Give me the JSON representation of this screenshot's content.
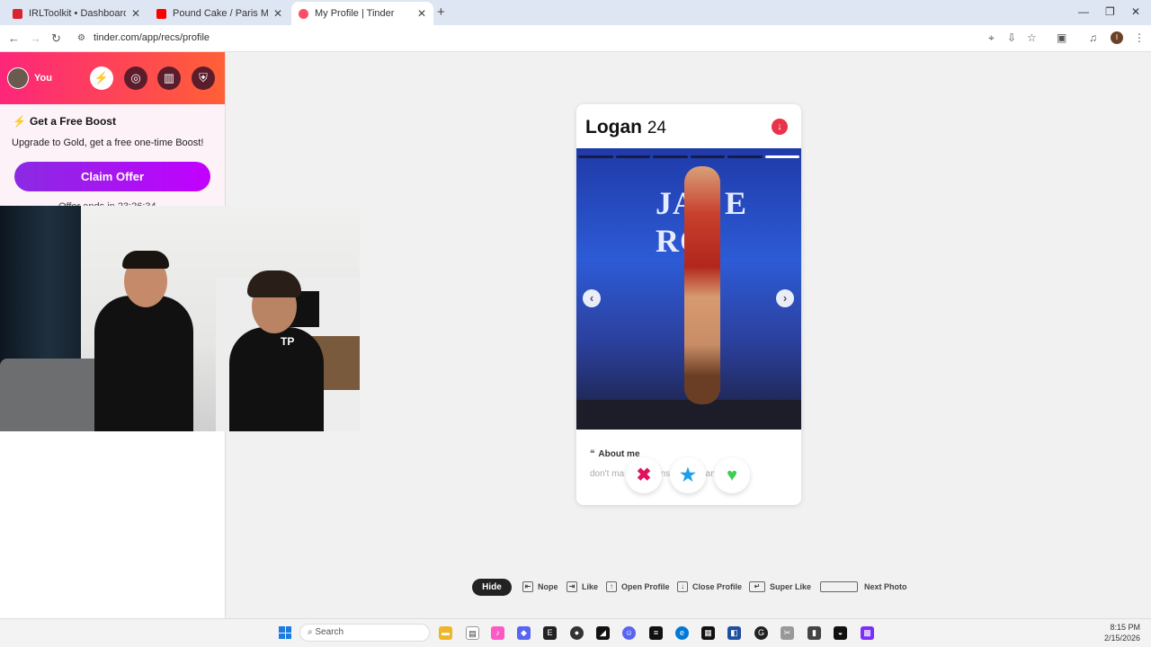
{
  "browser": {
    "tabs": [
      {
        "title": "IRLToolkit • Dashboard",
        "icon": "irltoolkit-icon",
        "color": "#d9232e"
      },
      {
        "title": "Pound Cake / Paris Morton Mu",
        "icon": "youtube-icon",
        "color": "#ff0000"
      },
      {
        "title": "My Profile | Tinder",
        "icon": "tinder-icon",
        "color": "#fd5068"
      }
    ],
    "url": "tinder.com/app/recs/profile",
    "profile_initial": "I"
  },
  "sidebar": {
    "user_label": "You",
    "boost_title": "Get a Free Boost",
    "boost_subtitle": "Upgrade to Gold, get a free one-time Boost!",
    "claim_button": "Claim Offer",
    "offer_text": "Offer ends in 23:26:34"
  },
  "profile": {
    "name": "Logan",
    "age": "24",
    "photo_sign": "JAS  E RO",
    "about_title": "About me",
    "about_text": "don't ma    eg    tin      p instagram     ganlis"
  },
  "hints": {
    "hide": "Hide",
    "nope": "Nope",
    "like": "Like",
    "open_profile": "Open Profile",
    "close_profile": "Close Profile",
    "super_like": "Super Like",
    "next_photo": "Next Photo"
  },
  "taskbar": {
    "search_placeholder": "Search",
    "time": "8:15 PM",
    "date": "2/15/2026"
  },
  "colors": {
    "tinder_gradient_start": "#fd267a",
    "tinder_gradient_end": "#ff6036",
    "claim_button": "#8a2be2",
    "nope": "#e0115f",
    "super_like": "#1ba0e5",
    "like": "#3ccf4e"
  }
}
